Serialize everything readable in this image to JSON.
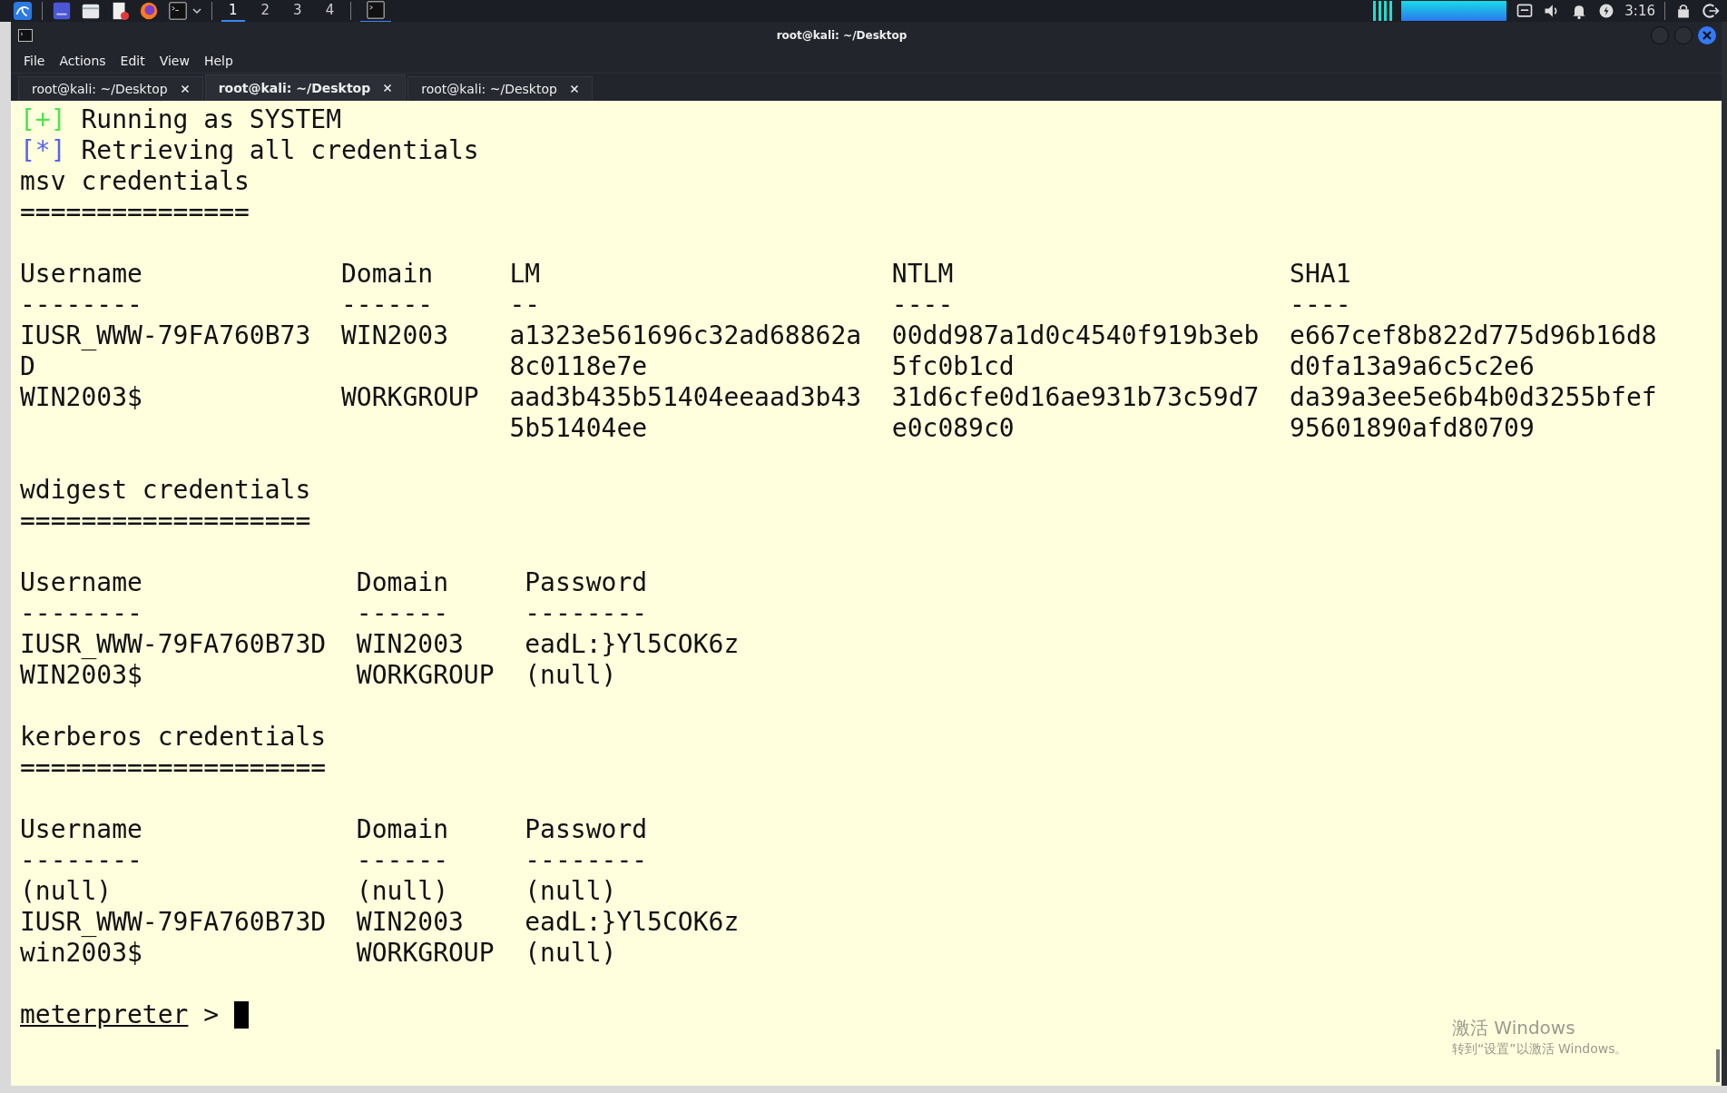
{
  "taskbar": {
    "workspaces": [
      {
        "label": "1",
        "selected": true
      },
      {
        "label": "2",
        "selected": false
      },
      {
        "label": "3",
        "selected": false
      },
      {
        "label": "4",
        "selected": false
      }
    ],
    "clock": "3:16"
  },
  "window": {
    "title": "root@kali: ~/Desktop"
  },
  "menu": [
    "File",
    "Actions",
    "Edit",
    "View",
    "Help"
  ],
  "tabs": [
    {
      "label": "root@kali: ~/Desktop",
      "selected": false
    },
    {
      "label": "root@kali: ~/Desktop",
      "selected": true
    },
    {
      "label": "root@kali: ~/Desktop",
      "selected": false
    }
  ],
  "terminal": {
    "blocks": [
      {
        "kind": "status",
        "marker": "[+]",
        "color": "#4ee44e",
        "text": "Running as SYSTEM"
      },
      {
        "kind": "status",
        "marker": "[*]",
        "color": "#5564f2",
        "text": "Retrieving all credentials"
      },
      {
        "kind": "heading",
        "text": "msv credentials"
      },
      {
        "kind": "rule",
        "text": "==============="
      },
      {
        "kind": "table",
        "columns": [
          {
            "label": "Username",
            "rule": "--------"
          },
          {
            "label": "Domain",
            "rule": "------"
          },
          {
            "label": "LM",
            "rule": "--"
          },
          {
            "label": "NTLM",
            "rule": "----"
          },
          {
            "label": "SHA1",
            "rule": "----"
          }
        ],
        "rows": [
          [
            "IUSR_WWW-79FA760B73D",
            "WIN2003",
            "a1323e561696c32ad68862a8c0118e7e",
            "00dd987a1d0c4540f919b3eb5fc0b1cd",
            "e667cef8b822d775d96b16d8d0fa13a9a6c5c2e6"
          ],
          [
            "WIN2003$",
            "WORKGROUP",
            "aad3b435b51404eeaad3b435b51404ee",
            "31d6cfe0d16ae931b73c59d7e0c089c0",
            "da39a3ee5e6b4b0d3255bfef95601890afd80709"
          ]
        ]
      },
      {
        "kind": "heading",
        "text": "wdigest credentials"
      },
      {
        "kind": "rule",
        "text": "==================="
      },
      {
        "kind": "table",
        "columns": [
          {
            "label": "Username",
            "rule": "--------"
          },
          {
            "label": "Domain",
            "rule": "------"
          },
          {
            "label": "Password",
            "rule": "--------"
          }
        ],
        "rows": [
          [
            "IUSR_WWW-79FA760B73D",
            "WIN2003",
            "eadL:}Yl5COK6z"
          ],
          [
            "WIN2003$",
            "WORKGROUP",
            "(null)"
          ]
        ]
      },
      {
        "kind": "heading",
        "text": "kerberos credentials"
      },
      {
        "kind": "rule",
        "text": "===================="
      },
      {
        "kind": "table",
        "columns": [
          {
            "label": "Username",
            "rule": "--------"
          },
          {
            "label": "Domain",
            "rule": "------"
          },
          {
            "label": "Password",
            "rule": "--------"
          }
        ],
        "rows": [
          [
            "(null)",
            "(null)",
            "(null)"
          ],
          [
            "IUSR_WWW-79FA760B73D",
            "WIN2003",
            "eadL:}Yl5COK6z"
          ],
          [
            "win2003$",
            "WORKGROUP",
            "(null)"
          ]
        ]
      },
      {
        "kind": "prompt",
        "text": "meterpreter",
        "symbol": ">"
      }
    ]
  },
  "activation_notice": {
    "title": "激活 Windows",
    "text": "转到“设置”以激活 Windows。"
  }
}
